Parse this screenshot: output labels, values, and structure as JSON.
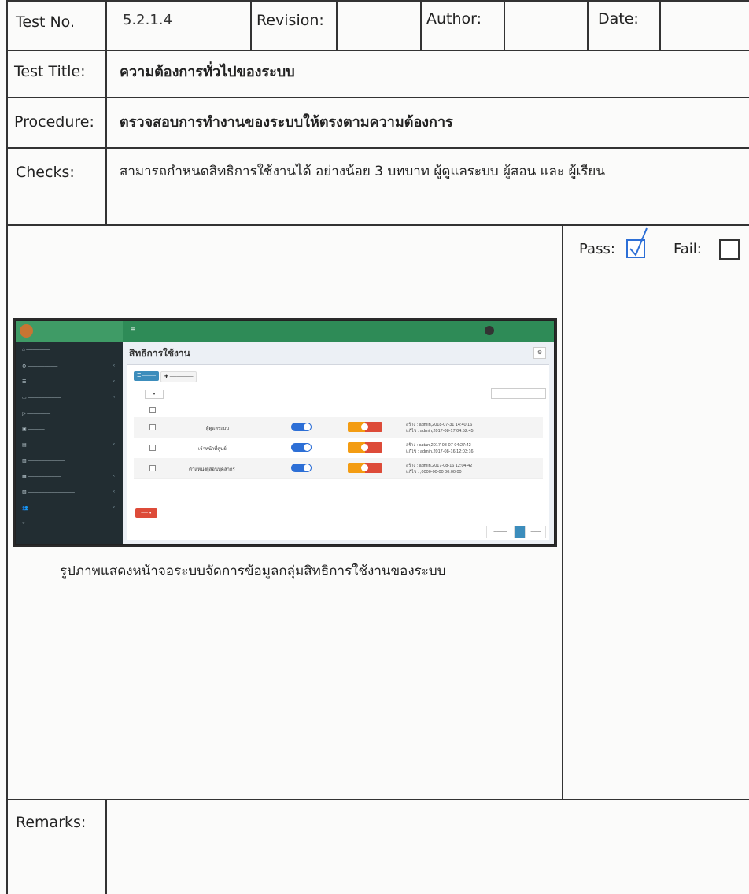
{
  "header": {
    "test_no_label": "Test No.",
    "test_no_value": "5.2.1.4",
    "revision_label": "Revision:",
    "revision_value": "",
    "author_label": "Author:",
    "author_value": "",
    "date_label": "Date:",
    "date_value": ""
  },
  "rows": {
    "title_label": "Test Title:",
    "title_value": "ความต้องการทั่วไปของระบบ",
    "procedure_label": "Procedure:",
    "procedure_value": "ตรวจสอบการทำงานของระบบให้ตรงตามความต้องการ",
    "checks_label": "Checks:",
    "checks_value": "สามารถกำหนดสิทธิการใช้งานได้ อย่างน้อย 3 บทบาท ผู้ดูแลระบบ ผู้สอน และ ผู้เรียน"
  },
  "result": {
    "pass_label": "Pass:",
    "pass_checked": true,
    "fail_label": "Fail:",
    "fail_checked": false
  },
  "caption": "รูปภาพแสดงหน้าจอระบบจัดการข้อมูลกลุ่มสิทธิการใช้งานของระบบ",
  "remarks_label": "Remarks:",
  "screenshot": {
    "page_title": "สิทธิการใช้งาน",
    "rows": [
      {
        "name": "ผู้ดูแลระบบ",
        "created": "สร้าง : admin,2018-07-31 14:40:16",
        "edited": "แก้ไข : admin,2017-08-17 04:52:45"
      },
      {
        "name": "เจ้าหน้าที่ศูนย์",
        "created": "สร้าง : satan,2017-08-07 04:27:42",
        "edited": "แก้ไข : admin,2017-08-16 12:03:16"
      },
      {
        "name": "ตำแหน่งผู้สอนบุคลากร",
        "created": "สร้าง : admin,2017-08-16 12:04:42",
        "edited": "แก้ไข : ,0000-00-00 00:00:00"
      }
    ]
  }
}
